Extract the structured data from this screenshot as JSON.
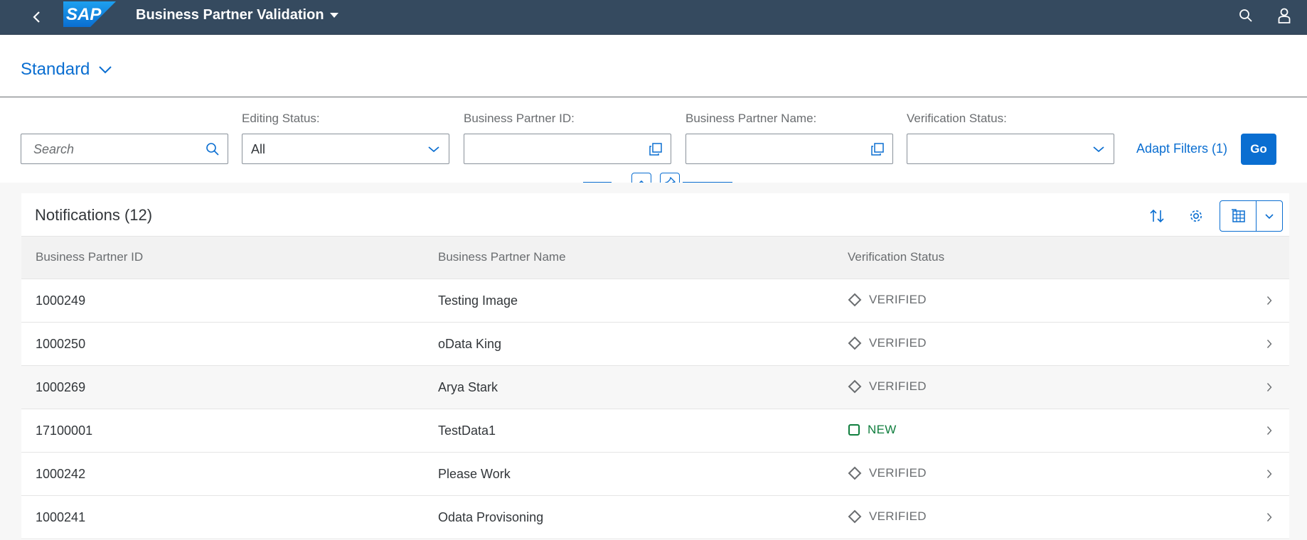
{
  "shell": {
    "app_title": "Business Partner Validation",
    "logo_text": "SAP"
  },
  "variant": {
    "name": "Standard"
  },
  "filters": {
    "search": {
      "placeholder": "Search",
      "value": ""
    },
    "editing_status": {
      "label": "Editing Status:",
      "value": "All"
    },
    "bp_id": {
      "label": "Business Partner ID:",
      "value": ""
    },
    "bp_name": {
      "label": "Business Partner Name:",
      "value": ""
    },
    "verification_status": {
      "label": "Verification Status:",
      "value": ""
    },
    "adapt_label": "Adapt Filters (1)",
    "go_label": "Go"
  },
  "table": {
    "title": "Notifications (12)",
    "columns": [
      "Business Partner ID",
      "Business Partner Name",
      "Verification Status"
    ],
    "rows": [
      {
        "id": "1000249",
        "name": "Testing Image",
        "status": "VERIFIED",
        "status_type": "verified"
      },
      {
        "id": "1000250",
        "name": "oData King",
        "status": "VERIFIED",
        "status_type": "verified"
      },
      {
        "id": "1000269",
        "name": "Arya Stark",
        "status": "VERIFIED",
        "status_type": "verified"
      },
      {
        "id": "17100001",
        "name": "TestData1",
        "status": "NEW",
        "status_type": "new"
      },
      {
        "id": "1000242",
        "name": "Please Work",
        "status": "VERIFIED",
        "status_type": "verified"
      },
      {
        "id": "1000241",
        "name": "Odata Provisoning",
        "status": "VERIFIED",
        "status_type": "verified"
      }
    ]
  },
  "icons": {
    "back": "back-arrow-icon",
    "search": "search-icon",
    "user": "user-icon",
    "dropdown": "chevron-down-icon",
    "value_help": "value-help-icon",
    "collapse": "chevron-up-icon",
    "pin": "pin-icon",
    "sort": "sort-icon",
    "settings": "gear-icon",
    "export": "export-spreadsheet-icon",
    "row_nav": "chevron-right-icon",
    "verified": "diamond-icon",
    "new": "square-icon"
  },
  "colors": {
    "shell_bg": "#354a5f",
    "accent": "#0a6ed1",
    "positive": "#107e3e",
    "neutral": "#6a6d70"
  }
}
